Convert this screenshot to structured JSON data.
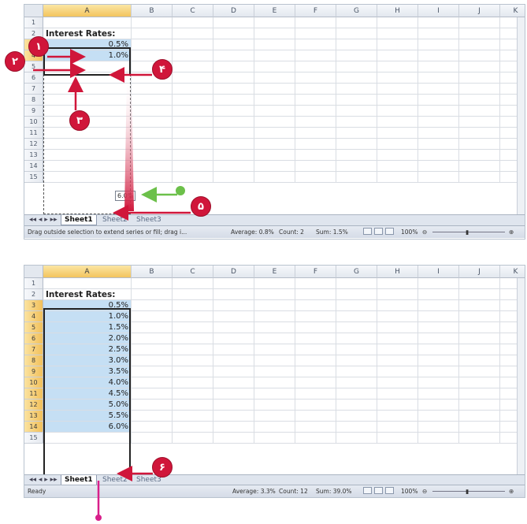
{
  "columns": [
    "A",
    "B",
    "C",
    "D",
    "E",
    "F",
    "G",
    "H",
    "I",
    "J",
    "K"
  ],
  "top": {
    "rows": [
      "1",
      "2",
      "3",
      "4",
      "5",
      "6",
      "7",
      "8",
      "9",
      "10",
      "11",
      "12",
      "13",
      "14",
      "15"
    ],
    "header_text": "Interest Rates:",
    "values": [
      "0.5%",
      "1.0%"
    ],
    "drag_tooltip": "6.0%",
    "tabs": [
      "Sheet1",
      "Sheet2",
      "Sheet3"
    ],
    "status_message": "Drag outside selection to extend series or fill; drag i...",
    "average": "Average: 0.8%",
    "count": "Count: 2",
    "sum": "Sum: 1.5%",
    "zoom": "100%"
  },
  "bottom": {
    "rows": [
      "1",
      "2",
      "3",
      "4",
      "5",
      "6",
      "7",
      "8",
      "9",
      "10",
      "11",
      "12",
      "13",
      "14",
      "15"
    ],
    "header_text": "Interest Rates:",
    "values": [
      "0.5%",
      "1.0%",
      "1.5%",
      "2.0%",
      "2.5%",
      "3.0%",
      "3.5%",
      "4.0%",
      "4.5%",
      "5.0%",
      "5.5%",
      "6.0%"
    ],
    "tabs": [
      "Sheet1",
      "Sheet2",
      "Sheet3"
    ],
    "status_ready": "Ready",
    "average": "Average: 3.3%",
    "count": "Count: 12",
    "sum": "Sum: 39.0%",
    "zoom": "100%"
  },
  "callouts": [
    "١",
    "٢",
    "٣",
    "۴",
    "۵",
    "۶"
  ],
  "colors": {
    "badge": "#d0163a",
    "arrow": "#d0163a",
    "green_arrow": "#6cc04a",
    "selection": "#c5dff4"
  }
}
